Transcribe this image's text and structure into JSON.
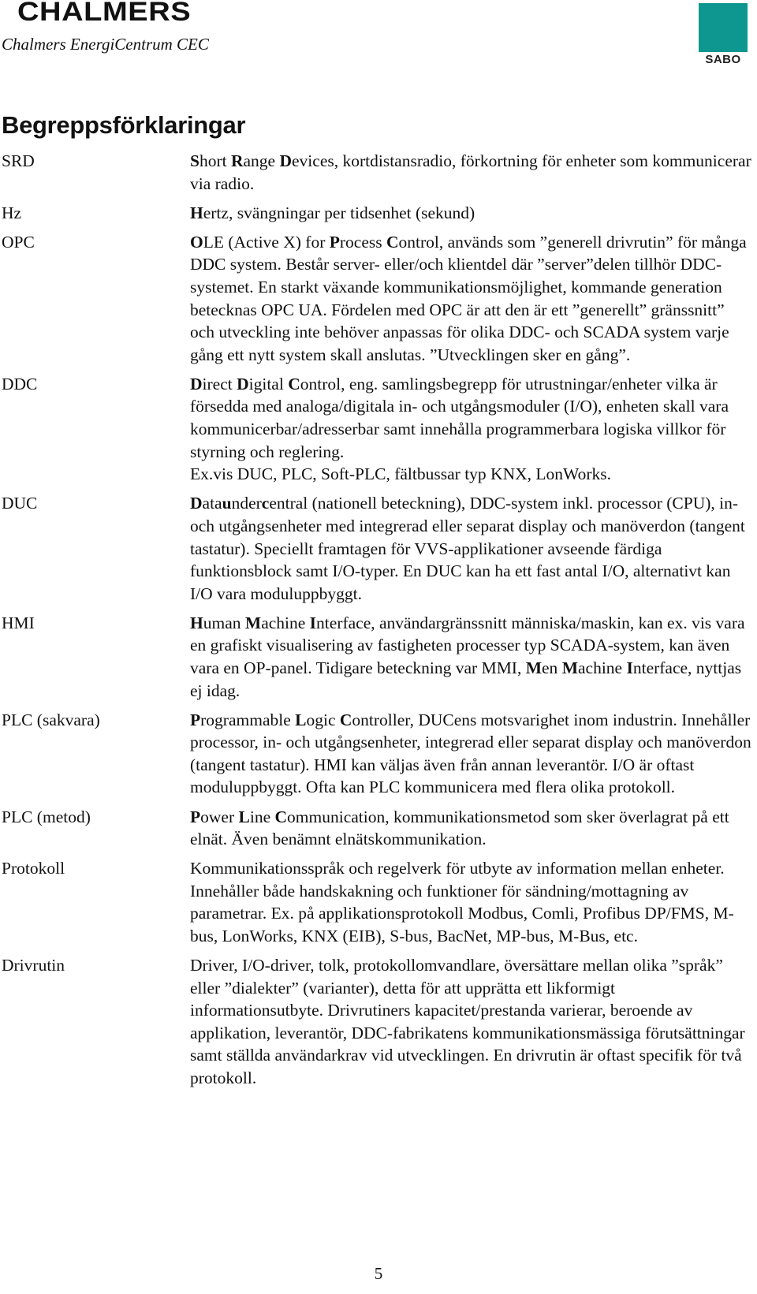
{
  "header": {
    "logo_left_title": "CHALMERS",
    "logo_left_subtitle": "Chalmers EnergiCentrum CEC",
    "logo_right_text": "SABO",
    "logo_right_color": "#0e9690"
  },
  "title": "Begreppsförklaringar",
  "entries": [
    {
      "term": "SRD",
      "definition": [
        {
          "b": true,
          "t": "S"
        },
        {
          "t": "hort "
        },
        {
          "b": true,
          "t": "R"
        },
        {
          "t": "ange "
        },
        {
          "b": true,
          "t": "D"
        },
        {
          "t": "evices, kortdistansradio, förkortning för enheter som kommunicerar via radio."
        }
      ]
    },
    {
      "term": "Hz",
      "definition": [
        {
          "b": true,
          "t": "H"
        },
        {
          "t": "ertz, svängningar per tidsenhet (sekund)"
        }
      ]
    },
    {
      "term": "OPC",
      "definition": [
        {
          "b": true,
          "t": "O"
        },
        {
          "t": "LE (Active X) for "
        },
        {
          "b": true,
          "t": "P"
        },
        {
          "t": "rocess "
        },
        {
          "b": true,
          "t": "C"
        },
        {
          "t": "ontrol, används som ”generell drivrutin” för många DDC system. Består server- eller/och klientdel där ”server”delen tillhör DDC-systemet. En starkt växande kommunikationsmöjlighet, kommande generation betecknas OPC UA. Fördelen med OPC är att den är ett ”generellt” gränssnitt” och utveckling inte behöver anpassas för olika DDC- och SCADA system varje gång ett nytt system skall anslutas. ”Utvecklingen sker en gång”."
        }
      ]
    },
    {
      "term": "DDC",
      "definition": [
        {
          "b": true,
          "t": "D"
        },
        {
          "t": "irect "
        },
        {
          "b": true,
          "t": "D"
        },
        {
          "t": "igital "
        },
        {
          "b": true,
          "t": "C"
        },
        {
          "t": "ontrol, eng. samlingsbegrepp för utrustningar/enheter vilka är försedda med analoga/digitala in- och utgångsmoduler (I/O), enheten skall vara kommunicerbar/adresserbar samt innehålla programmerbara logiska villkor för styrning och reglering."
        },
        {
          "br": true
        },
        {
          "t": "Ex.vis DUC, PLC, Soft-PLC, fältbussar typ KNX, LonWorks."
        }
      ]
    },
    {
      "term": "DUC",
      "definition": [
        {
          "b": true,
          "t": "D"
        },
        {
          "t": "ata"
        },
        {
          "b": true,
          "t": "u"
        },
        {
          "t": "nder"
        },
        {
          "b": true,
          "t": "c"
        },
        {
          "t": "entral (nationell beteckning), DDC-system inkl. processor (CPU), in- och utgångsenheter med integrerad eller separat display och manöverdon (tangent tastatur). Speciellt framtagen för VVS-applikationer avseende färdiga funktionsblock samt I/O-typer. En DUC kan ha ett fast antal I/O, alternativt kan I/O vara moduluppbyggt."
        }
      ]
    },
    {
      "term": "HMI",
      "definition": [
        {
          "b": true,
          "t": "H"
        },
        {
          "t": "uman "
        },
        {
          "b": true,
          "t": "M"
        },
        {
          "t": "achine "
        },
        {
          "b": true,
          "t": "I"
        },
        {
          "t": "nterface, användargränssnitt människa/maskin, kan ex. vis vara en grafiskt visualisering av fastigheten processer typ SCADA-system, kan även vara en OP-panel. Tidigare beteckning var MMI, "
        },
        {
          "b": true,
          "t": "M"
        },
        {
          "t": "en "
        },
        {
          "b": true,
          "t": "M"
        },
        {
          "t": "achine "
        },
        {
          "b": true,
          "t": "I"
        },
        {
          "t": "nterface, nyttjas ej idag."
        }
      ]
    },
    {
      "term": "PLC (sakvara)",
      "definition": [
        {
          "b": true,
          "t": "P"
        },
        {
          "t": "rogrammable "
        },
        {
          "b": true,
          "t": "L"
        },
        {
          "t": "ogic "
        },
        {
          "b": true,
          "t": "C"
        },
        {
          "t": "ontroller, DUCens motsvarighet inom industrin. Innehåller processor, in- och utgångsenheter, integrerad eller separat display och manöverdon (tangent tastatur). HMI kan väljas även från annan leverantör. I/O är oftast moduluppbyggt. Ofta kan PLC kommunicera med flera olika protokoll."
        }
      ]
    },
    {
      "term": "PLC (metod)",
      "definition": [
        {
          "b": true,
          "t": "P"
        },
        {
          "t": "ower "
        },
        {
          "b": true,
          "t": "L"
        },
        {
          "t": "ine "
        },
        {
          "b": true,
          "t": "C"
        },
        {
          "t": "ommunication, kommunikationsmetod som sker överlagrat på ett elnät. Även benämnt elnätskommunikation."
        }
      ]
    },
    {
      "term": "Protokoll",
      "definition": [
        {
          "t": "Kommunikationsspråk och regelverk för utbyte av information mellan enheter. Innehåller både handskakning och funktioner för sändning/mottagning av parametrar. Ex. på applikationsprotokoll Modbus, Comli, Profibus DP/FMS, M-bus, LonWorks, KNX (EIB), S-bus, BacNet, MP-bus, M-Bus, etc."
        }
      ]
    },
    {
      "term": "Drivrutin",
      "definition": [
        {
          "t": "Driver, I/O-driver, tolk, protokollomvandlare, översättare mellan olika ”språk” eller ”dialekter” (varianter), detta för att upprätta ett likformigt informationsutbyte. Drivrutiners kapacitet/prestanda varierar, beroende av applikation, leverantör, DDC-fabrikatens kommunikationsmässiga förutsättningar samt ställda användarkrav vid utvecklingen. En drivrutin är oftast specifik för två protokoll."
        }
      ]
    }
  ],
  "footer": {
    "page_number": "5"
  }
}
